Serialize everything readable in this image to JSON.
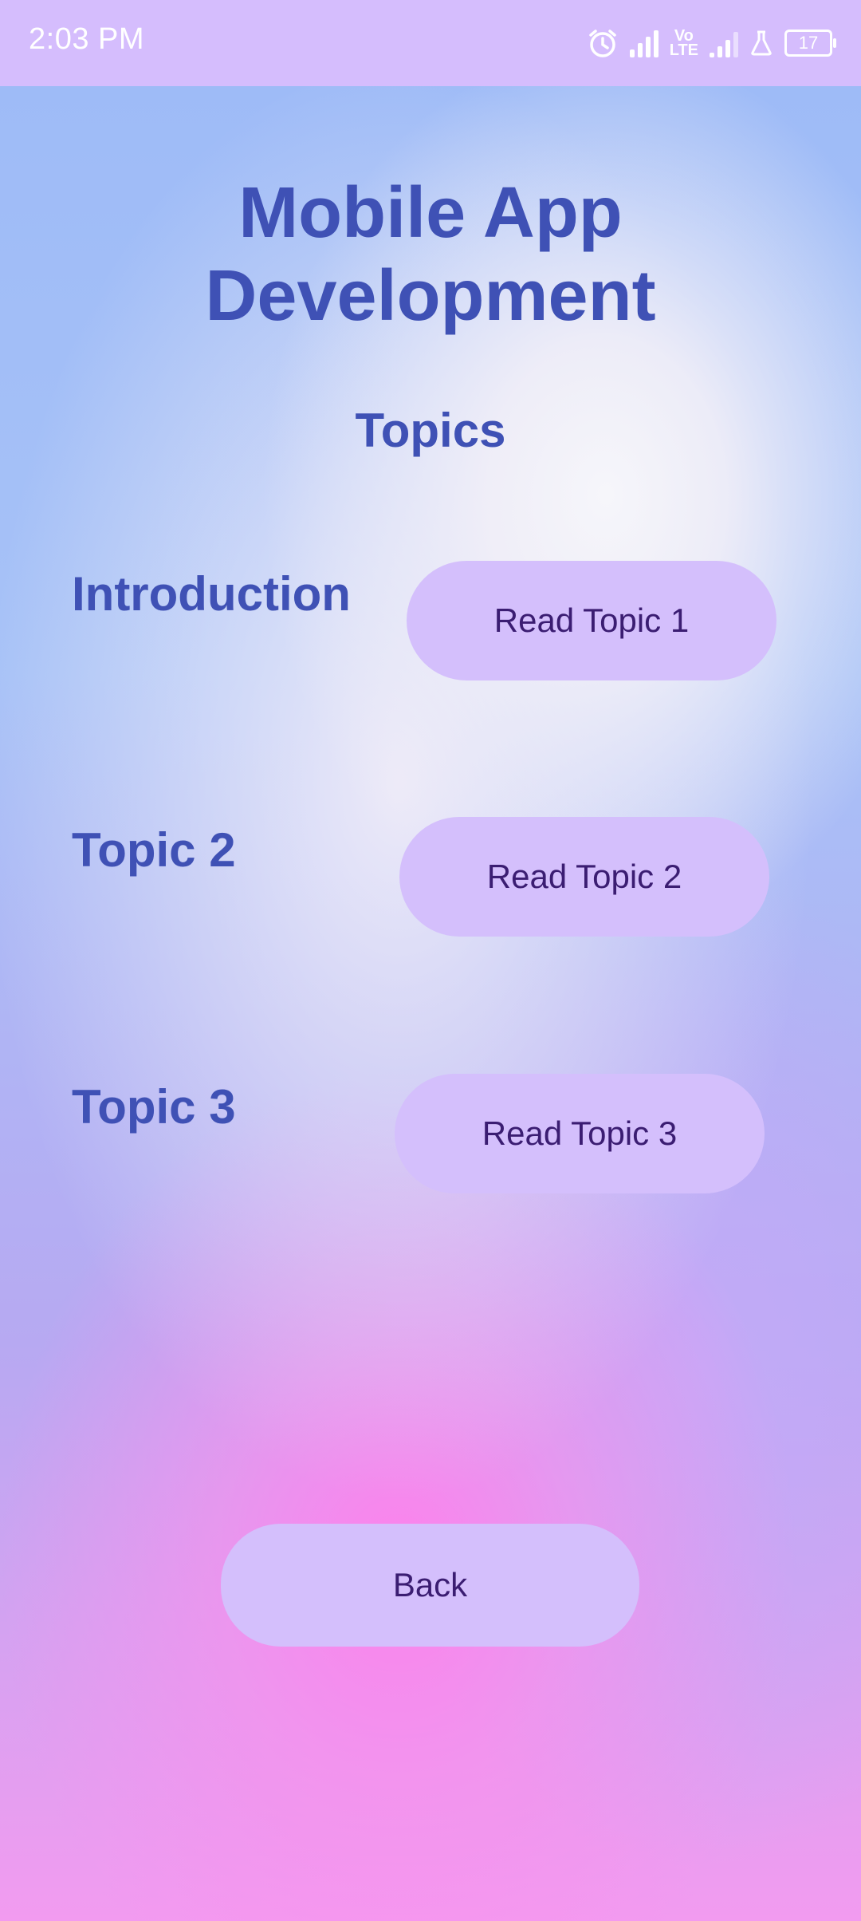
{
  "status_bar": {
    "time": "2:03 PM",
    "volte_top": "Vo",
    "volte_bottom": "LTE",
    "battery": "17"
  },
  "header": {
    "title_line1": "Mobile App",
    "title_line2": "Development",
    "subtitle": "Topics"
  },
  "topics": [
    {
      "label": "Introduction",
      "button": "Read Topic 1"
    },
    {
      "label": "Topic 2",
      "button": "Read Topic 2"
    },
    {
      "label": "Topic 3",
      "button": "Read Topic 3"
    }
  ],
  "footer": {
    "back_label": "Back"
  },
  "colors": {
    "status_bar": "#d5bdfd",
    "heading": "#3f51b5",
    "button_bg": "#d4bffc",
    "button_text": "#3b1d72"
  }
}
